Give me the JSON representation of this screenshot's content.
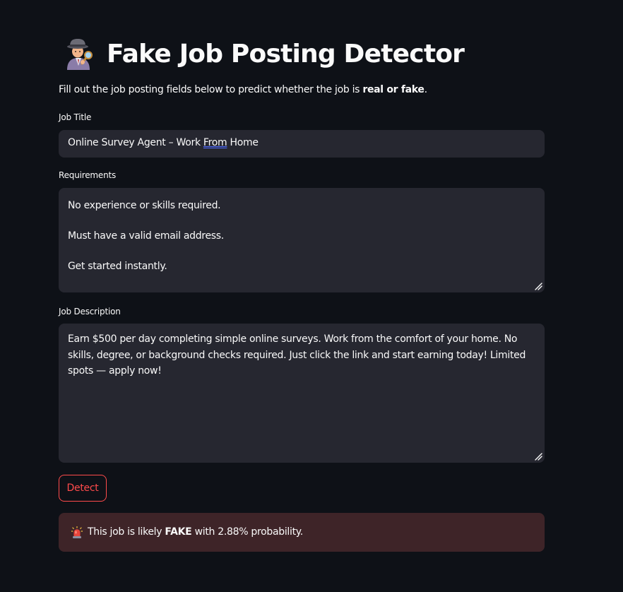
{
  "header": {
    "icon": "detective-emoji-icon",
    "title": "Fake Job Posting Detector"
  },
  "intro": {
    "text_before": "Fill out the job posting fields below to predict whether the job is ",
    "text_bold": "real or fake",
    "text_after": "."
  },
  "form": {
    "job_title": {
      "label": "Job Title",
      "value_before": "Online Survey Agent – Work ",
      "value_spell": "From",
      "value_after": " Home"
    },
    "requirements": {
      "label": "Requirements",
      "value": "No experience or skills required.\n\nMust have a valid email address.\n\nGet started instantly."
    },
    "job_description": {
      "label": "Job Description",
      "value": "Earn $500 per day completing simple online surveys. Work from the comfort of your home. No skills, degree, or background checks required. Just click the link and start earning today! Limited spots — apply now!"
    },
    "detect_label": "Detect"
  },
  "result": {
    "icon": "rotating-light-icon",
    "text_before": "This job is likely ",
    "text_bold": "FAKE",
    "text_after": " with 2.88% probability."
  },
  "colors": {
    "background": "#0e1117",
    "field_bg": "#262730",
    "accent": "#ff4b4b",
    "alert_bg": "#3e2428"
  }
}
